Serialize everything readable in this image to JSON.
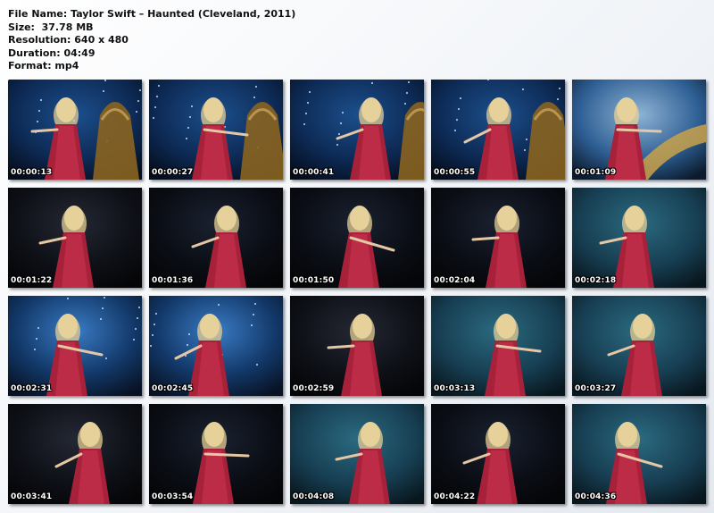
{
  "info": {
    "file_name": "File Name: Taylor Swift – Haunted (Cleveland, 2011)",
    "size": "Size:  37.78 MB",
    "resolution": "Resolution: 640 x 480",
    "duration": "Duration: 04:49",
    "format": "Format: mp4"
  },
  "thumbnails": [
    {
      "time": "00:00:13",
      "scene": "bell-blue"
    },
    {
      "time": "00:00:27",
      "scene": "bell-blue"
    },
    {
      "time": "00:00:41",
      "scene": "bell-blue"
    },
    {
      "time": "00:00:55",
      "scene": "bell-blue"
    },
    {
      "time": "00:01:09",
      "scene": "stairs"
    },
    {
      "time": "00:01:22",
      "scene": "dark-closeup"
    },
    {
      "time": "00:01:36",
      "scene": "dark"
    },
    {
      "time": "00:01:50",
      "scene": "dark"
    },
    {
      "time": "00:02:04",
      "scene": "dark"
    },
    {
      "time": "00:02:18",
      "scene": "teal"
    },
    {
      "time": "00:02:31",
      "scene": "blue-lights"
    },
    {
      "time": "00:02:45",
      "scene": "blue-lights"
    },
    {
      "time": "00:02:59",
      "scene": "dark-closeup"
    },
    {
      "time": "00:03:13",
      "scene": "teal"
    },
    {
      "time": "00:03:27",
      "scene": "teal"
    },
    {
      "time": "00:03:41",
      "scene": "dark-closeup"
    },
    {
      "time": "00:03:54",
      "scene": "dark"
    },
    {
      "time": "00:04:08",
      "scene": "teal"
    },
    {
      "time": "00:04:22",
      "scene": "dark"
    },
    {
      "time": "00:04:36",
      "scene": "teal"
    }
  ]
}
